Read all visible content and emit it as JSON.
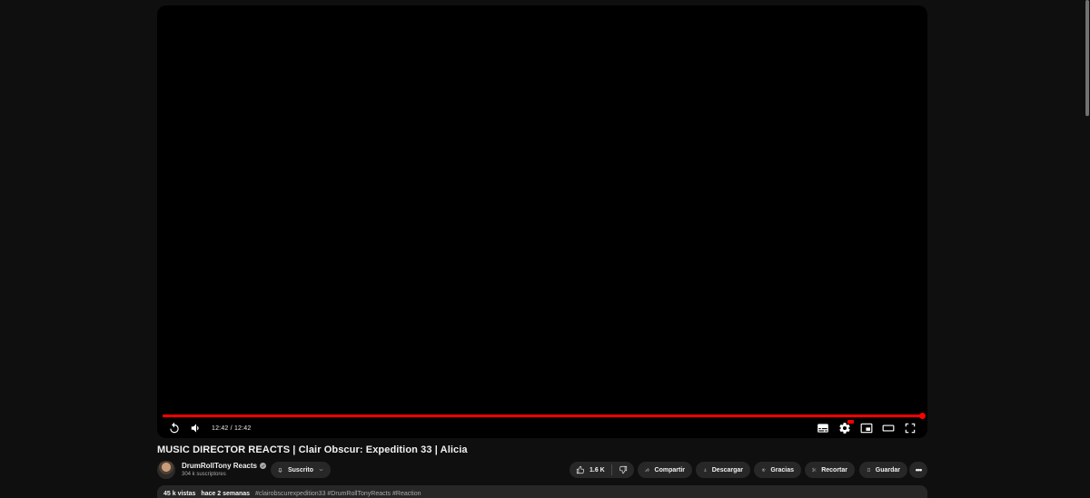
{
  "player": {
    "time_display": "12:42 / 12:42",
    "progress": 1.0,
    "accent_color": "#ff0000"
  },
  "video": {
    "title": "MUSIC DIRECTOR REACTS | Clair Obscur: Expedition 33 | Alicia"
  },
  "channel": {
    "name": "DrumRollTony Reacts",
    "subscribers": "304 k suscriptores",
    "subscribe_label": "Suscrito"
  },
  "actions": {
    "like_count": "1.6 K",
    "share_label": "Compartir",
    "download_label": "Descargar",
    "thanks_label": "Gracias",
    "clip_label": "Recortar",
    "save_label": "Guardar"
  },
  "description": {
    "views": "45 k vistas",
    "age": "hace 2 semanas",
    "tags": "#clairobscurexpedition33 #DrumRollTonyReacts #Reaction"
  },
  "icons": {
    "replay": "replay-icon",
    "volume": "volume-icon",
    "subtitles": "subtitles-icon",
    "settings": "settings-icon",
    "miniplayer": "miniplayer-icon",
    "theater": "theater-mode-icon",
    "fullscreen": "fullscreen-icon",
    "bell": "bell-icon",
    "like": "thumbs-up-icon",
    "dislike": "thumbs-down-icon",
    "share": "share-icon",
    "download": "download-icon",
    "thanks": "thanks-icon",
    "clip": "scissors-icon",
    "save": "bookmark-icon",
    "more": "more-icon"
  }
}
